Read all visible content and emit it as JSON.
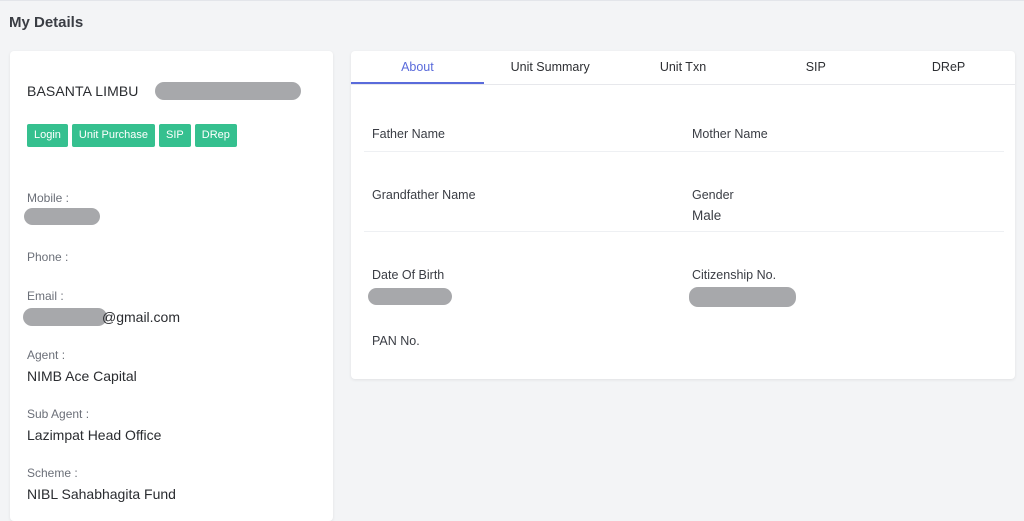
{
  "page": {
    "title": "My Details"
  },
  "profile": {
    "name": "BASANTA LIMBU",
    "buttons": [
      "Login",
      "Unit Purchase",
      "SIP",
      "DRep"
    ],
    "fields": {
      "mobile": {
        "label": "Mobile :",
        "value": ""
      },
      "phone": {
        "label": "Phone :",
        "value": ""
      },
      "email": {
        "label": "Email :",
        "value": "@gmail.com"
      },
      "agent": {
        "label": "Agent :",
        "value": "NIMB Ace Capital"
      },
      "sub_agent": {
        "label": "Sub Agent :",
        "value": "Lazimpat Head Office"
      },
      "scheme": {
        "label": "Scheme :",
        "value": "NIBL Sahabhagita Fund"
      }
    }
  },
  "tabs": [
    "About",
    "Unit Summary",
    "Unit Txn",
    "SIP",
    "DReP"
  ],
  "active_tab": "About",
  "about": {
    "father_name": {
      "label": "Father Name",
      "value": ""
    },
    "mother_name": {
      "label": "Mother Name",
      "value": ""
    },
    "grandfather_name": {
      "label": "Grandfather Name",
      "value": ""
    },
    "gender": {
      "label": "Gender",
      "value": "Male"
    },
    "dob": {
      "label": "Date Of Birth",
      "value": ""
    },
    "citizenship": {
      "label": "Citizenship No.",
      "value": ""
    },
    "pan": {
      "label": "PAN No.",
      "value": ""
    }
  },
  "colors": {
    "accent": "#5a6bdb",
    "button": "#35c08f",
    "background": "#f3f4f6",
    "redaction": "#a7a8ab"
  }
}
